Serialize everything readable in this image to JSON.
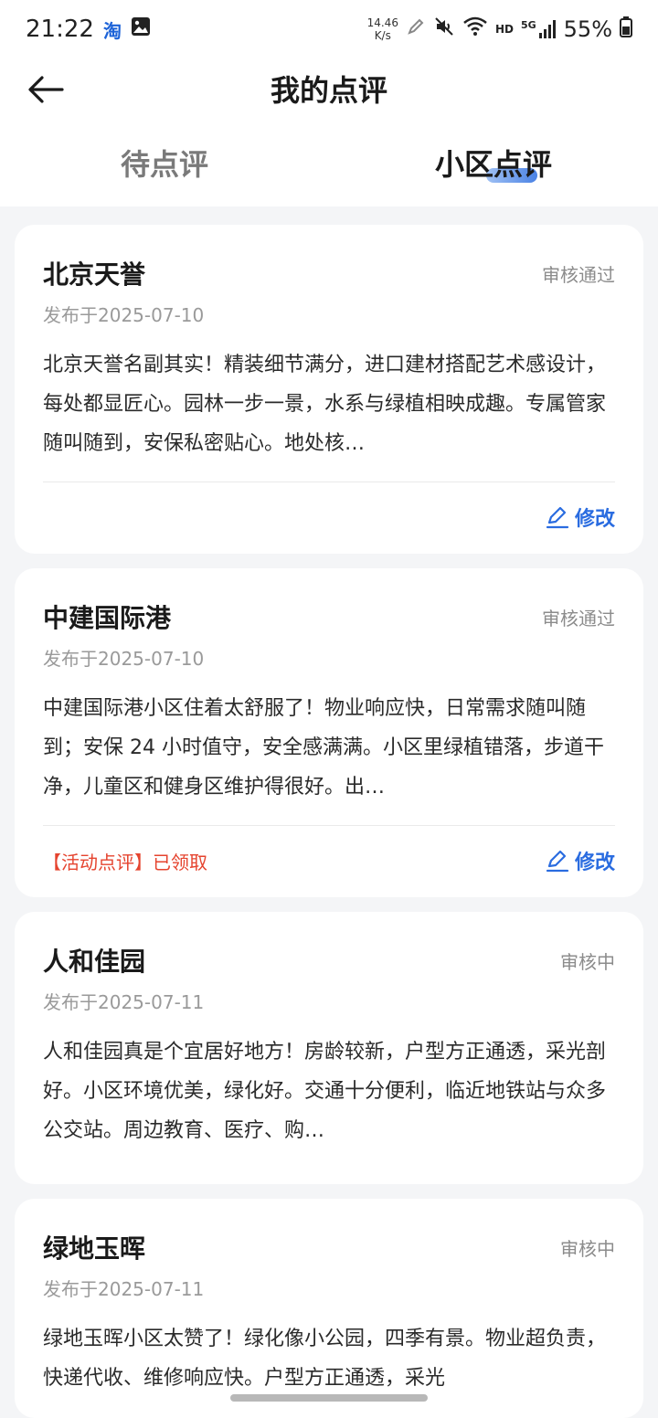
{
  "status": {
    "time": "21:22",
    "taobao": "淘",
    "netspeed_value": "14.46",
    "netspeed_unit": "K/s",
    "hd": "HD",
    "network": "5G",
    "battery": "55%"
  },
  "header": {
    "title": "我的点评"
  },
  "tabs": [
    {
      "label": "待点评",
      "active": false
    },
    {
      "label": "小区点评",
      "active": true
    }
  ],
  "cards": [
    {
      "name": "北京天誉",
      "status": "审核通过",
      "date": "发布于2025-07-10",
      "text": "北京天誉名副其实！精装细节满分，进口建材搭配艺术感设计，每处都显匠心。园林一步一景，水系与绿植相映成趣。专属管家随叫随到，安保私密贴心。地处核…",
      "activity": "",
      "edit_label": "修改"
    },
    {
      "name": "中建国际港",
      "status": "审核通过",
      "date": "发布于2025-07-10",
      "text": "中建国际港小区住着太舒服了！物业响应快，日常需求随叫随到；安保 24 小时值守，安全感满满。小区里绿植错落，步道干净，儿童区和健身区维护得很好。出…",
      "activity": "【活动点评】已领取",
      "edit_label": "修改"
    },
    {
      "name": "人和佳园",
      "status": "审核中",
      "date": "发布于2025-07-11",
      "text": "人和佳园真是个宜居好地方！房龄较新，户型方正通透，采光剖好。小区环境优美，绿化好。交通十分便利，临近地铁站与众多公交站。周边教育、医疗、购…"
    },
    {
      "name": "绿地玉晖",
      "status": "审核中",
      "date": "发布于2025-07-11",
      "text": "绿地玉晖小区太赞了！绿化像小公园，四季有景。物业超负责，快递代收、维修响应快。户型方正通透，采光"
    }
  ]
}
